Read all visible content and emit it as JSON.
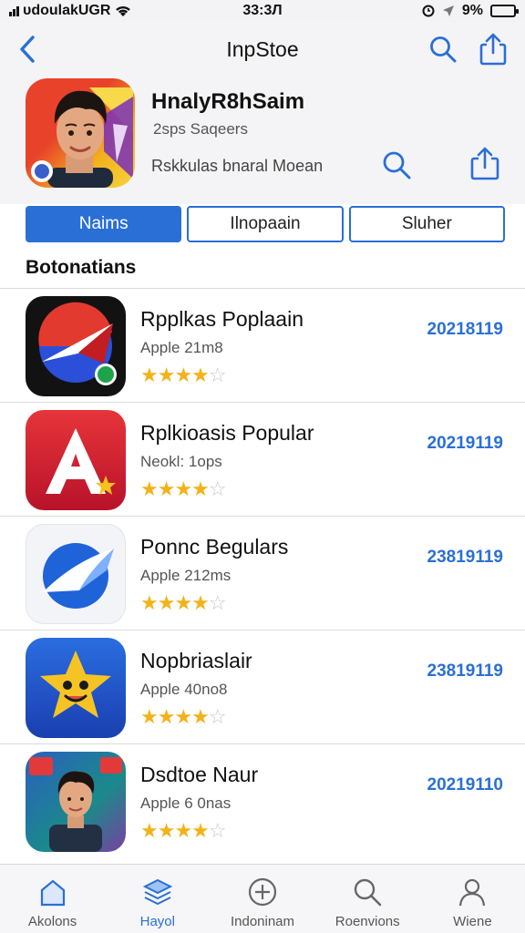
{
  "status_bar": {
    "carrier": "ᴜdoulakUGR",
    "time": "33:3Л",
    "battery": "9%",
    "battery_level": 0.9
  },
  "nav": {
    "title": "InpStoe"
  },
  "app": {
    "name": "HnalyR8hSaim",
    "subtitle": "2sps Saqeers",
    "developer": "Rskkulas bnaral Moean"
  },
  "segments": [
    {
      "label": "Naims",
      "active": true
    },
    {
      "label": "Ilnopaain",
      "active": false
    },
    {
      "label": "Sluher",
      "active": false
    }
  ],
  "section": {
    "title": "Botonatians"
  },
  "apps": [
    {
      "name": "Rpplkas Poplaain",
      "sub": "Apple 21m8",
      "rating": 4,
      "value": "20218119"
    },
    {
      "name": "Rplkioasis Popular",
      "sub": "Neokl: 1ops",
      "rating": 4,
      "value": "20219119"
    },
    {
      "name": "Ponnc Begulars",
      "sub": "Apple 212ms",
      "rating": 4,
      "value": "23819119"
    },
    {
      "name": "Nopbriaslair",
      "sub": "Apple 40no8",
      "rating": 4,
      "value": "23819119"
    },
    {
      "name": "Dsdtoe Naur",
      "sub": "Apple 6 0nas",
      "rating": 4,
      "value": "20219110"
    }
  ],
  "tabs": [
    {
      "label": "Akolons",
      "icon": "home-icon",
      "active": false
    },
    {
      "label": "Hayol",
      "icon": "stack-icon",
      "active": true
    },
    {
      "label": "Indoninam",
      "icon": "plus-circle-icon",
      "active": false
    },
    {
      "label": "Roenvions",
      "icon": "search-icon",
      "active": false
    },
    {
      "label": "Wiene",
      "icon": "person-icon",
      "active": false
    }
  ],
  "colors": {
    "accent": "#2a6fd6",
    "star": "#f2b319"
  }
}
